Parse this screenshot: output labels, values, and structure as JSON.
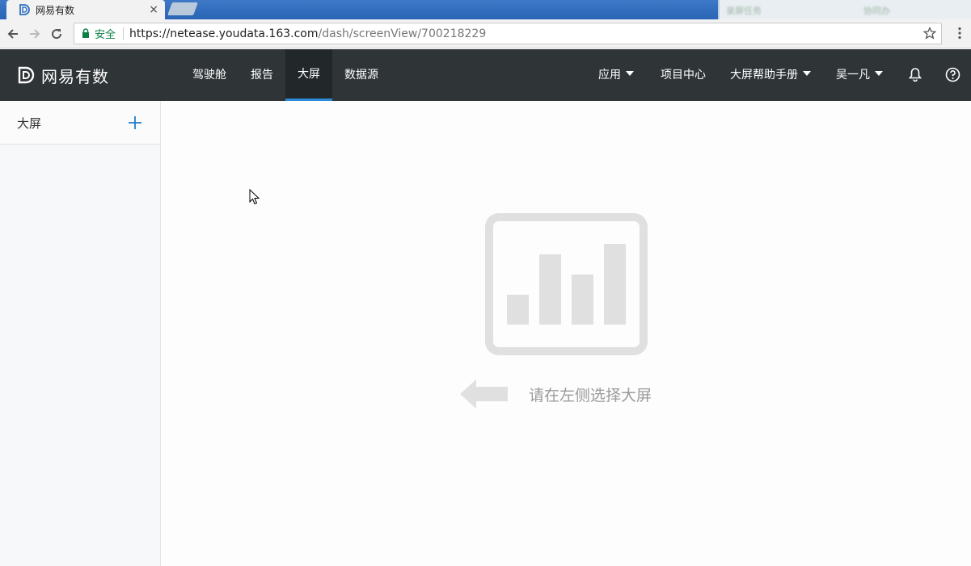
{
  "browser": {
    "tab_title": "网易有数",
    "tab_close": "×",
    "taskbar_items": [
      "录屏任务",
      "协同办"
    ],
    "secure_label": "安全",
    "url_host": "https://netease.youdata.163.com",
    "url_path": "/dash/screenView/700218229"
  },
  "app": {
    "brand_name": "网易有数",
    "nav": [
      {
        "label": "驾驶舱"
      },
      {
        "label": "报告"
      },
      {
        "label": "大屏",
        "active": true
      },
      {
        "label": "数据源"
      }
    ],
    "right_nav": [
      {
        "label": "应用",
        "dropdown": true
      },
      {
        "label": "项目中心"
      },
      {
        "label": "大屏帮助手册",
        "dropdown": true
      },
      {
        "label": "吴一凡",
        "dropdown": true
      }
    ],
    "icons": [
      "bell-icon",
      "help-icon"
    ]
  },
  "sidebar": {
    "title": "大屏",
    "add_icon": "plus-icon"
  },
  "main": {
    "empty_text": "请在左侧选择大屏",
    "empty_icon": "bar-chart-icon"
  },
  "colors": {
    "header_bg": "#2f3437",
    "active_underline": "#2d8ad8",
    "accent": "#1f7dc9",
    "empty_gray": "#e0e0e0"
  }
}
